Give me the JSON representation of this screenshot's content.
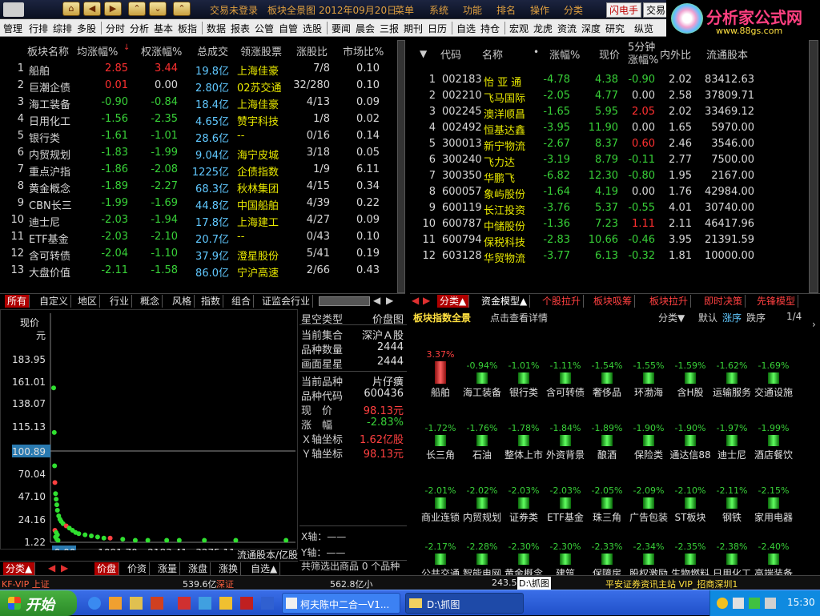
{
  "titlebar": {
    "status": "交易未登录",
    "board": "板块全景图",
    "date": "2012年09月20日",
    "menus": [
      "菜单",
      "系统",
      "功能",
      "排名",
      "操作",
      "分类"
    ],
    "flash": "闪电手",
    "trade": "交易"
  },
  "menubar": {
    "items": [
      "管理",
      "行排",
      "综排",
      "多股",
      "分时",
      "分析",
      "基本",
      "板指",
      "数据",
      "报表",
      "公管",
      "自管",
      "选股",
      "要闻",
      "晨会",
      "三报",
      "期刊",
      "日历",
      "自选",
      "持仓",
      "宏观",
      "龙虎",
      "资流",
      "深度",
      "研究",
      "纵览"
    ]
  },
  "logo": {
    "title": "分析家公式网",
    "url": "www.88gs.com"
  },
  "left_table": {
    "headers": [
      "板块名称",
      "均涨幅%",
      "权涨幅%",
      "总成交",
      "领涨股票",
      "涨股比",
      "市场比%"
    ],
    "rows": [
      [
        "1",
        "船舶",
        "2.85",
        "3.44",
        "19.8亿",
        "上海佳豪",
        "7/8",
        "0.10"
      ],
      [
        "2",
        "巨潮企债",
        "0.01",
        "0.00",
        "2.80亿",
        "02苏交通",
        "32/280",
        "0.10"
      ],
      [
        "3",
        "海工装备",
        "-0.90",
        "-0.84",
        "18.4亿",
        "上海佳豪",
        "4/13",
        "0.09"
      ],
      [
        "4",
        "日用化工",
        "-1.56",
        "-2.35",
        "4.65亿",
        "赞宇科技",
        "1/8",
        "0.02"
      ],
      [
        "5",
        "银行类",
        "-1.61",
        "-1.01",
        "28.6亿",
        "--",
        "0/16",
        "0.14"
      ],
      [
        "6",
        "内贸规划",
        "-1.83",
        "-1.99",
        "9.04亿",
        "海宁皮城",
        "3/18",
        "0.05"
      ],
      [
        "7",
        "重点沪指",
        "-1.86",
        "-2.08",
        "1225亿",
        "企债指数",
        "1/9",
        "6.11"
      ],
      [
        "8",
        "黄金概念",
        "-1.89",
        "-2.27",
        "68.3亿",
        "秋林集团",
        "4/15",
        "0.34"
      ],
      [
        "9",
        "CBN长三",
        "-1.99",
        "-1.69",
        "44.8亿",
        "中国船舶",
        "4/39",
        "0.22"
      ],
      [
        "10",
        "迪士尼",
        "-2.03",
        "-1.94",
        "17.8亿",
        "上海建工",
        "4/27",
        "0.09"
      ],
      [
        "11",
        "ETF基金",
        "-2.03",
        "-2.10",
        "20.7亿",
        "--",
        "0/43",
        "0.10"
      ],
      [
        "12",
        "含可转债",
        "-2.04",
        "-1.10",
        "37.9亿",
        "澄星股份",
        "5/41",
        "0.19"
      ],
      [
        "13",
        "大盘价值",
        "-2.11",
        "-1.58",
        "86.0亿",
        "宁沪高速",
        "2/66",
        "0.43"
      ]
    ]
  },
  "right_table": {
    "headers": [
      "代码",
      "名称",
      "涨幅%",
      "现价",
      "5分钟涨幅%",
      "内外比",
      "流通股本"
    ],
    "rows": [
      [
        "1",
        "002183",
        "怡 亚 通",
        "-4.78",
        "4.38",
        "-0.90",
        "2.02",
        "83412.63"
      ],
      [
        "2",
        "002210",
        "飞马国际",
        "-2.05",
        "4.77",
        "0.00",
        "2.58",
        "37809.71"
      ],
      [
        "3",
        "002245",
        "澳洋顺昌",
        "-1.65",
        "5.95",
        "2.05",
        "2.02",
        "33469.12"
      ],
      [
        "4",
        "002492",
        "恒基达鑫",
        "-3.95",
        "11.90",
        "0.00",
        "1.65",
        "5970.00"
      ],
      [
        "5",
        "300013",
        "新宁物流",
        "-2.67",
        "8.37",
        "0.60",
        "2.46",
        "3546.00"
      ],
      [
        "6",
        "300240",
        "飞力达",
        "-3.19",
        "8.79",
        "-0.11",
        "2.77",
        "7500.00"
      ],
      [
        "7",
        "300350",
        "华鹏飞",
        "-6.82",
        "12.30",
        "-0.80",
        "1.95",
        "2167.00"
      ],
      [
        "8",
        "600057",
        "象屿股份",
        "-1.64",
        "4.19",
        "0.00",
        "1.76",
        "42984.00"
      ],
      [
        "9",
        "600119",
        "长江投资",
        "-3.76",
        "5.37",
        "-0.55",
        "4.01",
        "30740.00"
      ],
      [
        "10",
        "600787",
        "中储股份",
        "-1.36",
        "7.23",
        "1.11",
        "2.11",
        "46417.96"
      ],
      [
        "11",
        "600794",
        "保税科技",
        "-2.83",
        "10.66",
        "-0.46",
        "3.95",
        "21391.59"
      ],
      [
        "12",
        "603128",
        "华贸物流",
        "-3.77",
        "6.13",
        "-0.32",
        "1.81",
        "10000.00"
      ]
    ]
  },
  "left_tabs": [
    "所有",
    "自定义",
    "地区",
    "行业",
    "概念",
    "风格",
    "指数",
    "组合",
    "证监会行业"
  ],
  "right_tabs": [
    "分类▲",
    "资金模型▲",
    "个股拉升",
    "板块吸筹",
    "板块拉升",
    "即时决策",
    "先锋模型"
  ],
  "chart_tabs": [
    "分类▲",
    "价盘",
    "价资",
    "涨量",
    "涨盘",
    "涨换",
    "自选▲"
  ],
  "chart": {
    "ylabel": "现价元",
    "yticks": [
      "183.95",
      "161.01",
      "138.07",
      "115.13",
      "100.89",
      "70.04",
      "47.10",
      "24.16",
      "1.22"
    ],
    "xticks": [
      "0.00",
      "1091.70",
      "2183.41",
      "3275.11"
    ],
    "xlabel": "流通股本/亿股"
  },
  "chart_data": {
    "type": "scatter",
    "xlabel": "流通股本/亿股",
    "ylabel": "现价元",
    "xlim": [
      0,
      3800
    ],
    "ylim": [
      1.22,
      200
    ],
    "points": [
      [
        0,
        140
      ],
      [
        10,
        100
      ],
      [
        15,
        70
      ],
      [
        20,
        55
      ],
      [
        30,
        45
      ],
      [
        40,
        40
      ],
      [
        50,
        35
      ],
      [
        60,
        30
      ],
      [
        80,
        25
      ],
      [
        100,
        22
      ],
      [
        120,
        20
      ],
      [
        150,
        18
      ],
      [
        200,
        16
      ],
      [
        250,
        14
      ],
      [
        300,
        12
      ],
      [
        350,
        10
      ],
      [
        400,
        9
      ],
      [
        500,
        8
      ],
      [
        600,
        7
      ],
      [
        700,
        6
      ],
      [
        800,
        5
      ],
      [
        900,
        5
      ],
      [
        1100,
        4
      ],
      [
        1300,
        3
      ],
      [
        1500,
        3
      ],
      [
        1800,
        3
      ],
      [
        2000,
        3
      ],
      [
        2400,
        3
      ],
      [
        2900,
        3
      ],
      [
        3700,
        3
      ],
      [
        20,
        12
      ],
      [
        40,
        10
      ],
      [
        60,
        8
      ],
      [
        30,
        6
      ],
      [
        50,
        4
      ],
      [
        70,
        3
      ]
    ]
  },
  "info": {
    "title": "星空类型",
    "title_val": "价盘图",
    "rows": [
      [
        "当前集合",
        "深沪Ａ股"
      ],
      [
        "品种数量",
        "2444"
      ],
      [
        "画面星星",
        "2444"
      ],
      [
        "当前品种",
        "片仔癀"
      ],
      [
        "品种代码",
        "600436"
      ],
      [
        "现　价",
        "98.13元"
      ],
      [
        "涨　幅",
        "-2.83%"
      ],
      [
        "Ｘ轴坐标",
        "1.62亿股"
      ],
      [
        "Ｙ轴坐标",
        "98.13元"
      ]
    ],
    "x_axis": "X轴：——",
    "y_axis": "Y轴：——",
    "footer": "共筛选出商品 0 个品种"
  },
  "blocks": {
    "title": "板块指数全景",
    "hint": "点击查看详情",
    "sort": "分类▼",
    "opt1": "默认",
    "opt2": "涨序",
    "opt3": "跌序",
    "page": "1/4",
    "items": [
      [
        "3.37%",
        "船舶",
        1
      ],
      [
        "-0.94%",
        "海工装备",
        0
      ],
      [
        "-1.01%",
        "银行类",
        0
      ],
      [
        "-1.11%",
        "含可转债",
        0
      ],
      [
        "-1.54%",
        "奢侈品",
        0
      ],
      [
        "-1.55%",
        "环渤海",
        0
      ],
      [
        "-1.59%",
        "含H股",
        0
      ],
      [
        "-1.62%",
        "运输服务",
        0
      ],
      [
        "-1.69%",
        "交通设施",
        0
      ],
      [
        "-1.72%",
        "长三角",
        0
      ],
      [
        "-1.76%",
        "石油",
        0
      ],
      [
        "-1.78%",
        "整体上市",
        0
      ],
      [
        "-1.84%",
        "外资背景",
        0
      ],
      [
        "-1.89%",
        "酿酒",
        0
      ],
      [
        "-1.90%",
        "保险类",
        0
      ],
      [
        "-1.90%",
        "通达信88",
        0
      ],
      [
        "-1.97%",
        "迪士尼",
        0
      ],
      [
        "-1.99%",
        "酒店餐饮",
        0
      ],
      [
        "-2.01%",
        "商业连锁",
        0
      ],
      [
        "-2.02%",
        "内贸规划",
        0
      ],
      [
        "-2.03%",
        "证券类",
        0
      ],
      [
        "-2.03%",
        "ETF基金",
        0
      ],
      [
        "-2.05%",
        "珠三角",
        0
      ],
      [
        "-2.09%",
        "广告包装",
        0
      ],
      [
        "-2.10%",
        "ST板块",
        0
      ],
      [
        "-2.11%",
        "钢铁",
        0
      ],
      [
        "-2.15%",
        "家用电器",
        0
      ],
      [
        "-2.17%",
        "公共交通",
        0
      ],
      [
        "-2.28%",
        "智能电网",
        0
      ],
      [
        "-2.30%",
        "黄金概念",
        0
      ],
      [
        "-2.30%",
        "建筑",
        0
      ],
      [
        "-2.33%",
        "保障房",
        0
      ],
      [
        "-2.34%",
        "股权激励",
        0
      ],
      [
        "-2.35%",
        "生物燃料",
        0
      ],
      [
        "-2.38%",
        "日用化工",
        0
      ],
      [
        "-2.40%",
        "高端装备",
        0
      ]
    ]
  },
  "statusbar": {
    "left": "KF-VIP 上证",
    "mid1": "539.6亿",
    "mid2": "深证",
    "mid3": "562.8亿小",
    "mid4": "243.5",
    "path": "D:\\抓图",
    "right": "平安证券资讯主站 VIP_招商深圳1"
  },
  "taskbar": {
    "start": "开始",
    "task1": "柯夫陈中二合一V1...",
    "task2": "D:\\抓图",
    "clock": "15:30"
  },
  "colors": {
    "up": "#ff3030",
    "down": "#38d038",
    "accent": "#e0a040"
  }
}
